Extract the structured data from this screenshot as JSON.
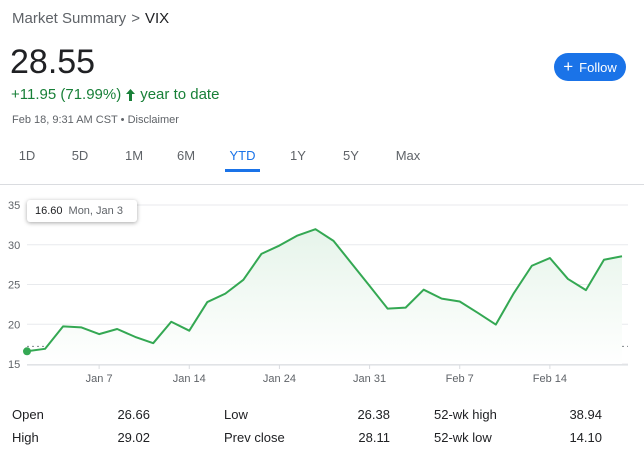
{
  "breadcrumb": {
    "parent": "Market Summary",
    "separator": ">",
    "current": "VIX"
  },
  "quote": {
    "price": "28.55",
    "change": "+11.95 (71.99%)",
    "change_icon": "arrow-up-icon",
    "period": "year to date",
    "timestamp": "Feb 18, 9:31 AM CST",
    "bullet": "•",
    "disclaimer": "Disclaimer"
  },
  "follow_button": {
    "label": "Follow",
    "icon": "plus-icon"
  },
  "tabs": [
    {
      "label": "1D",
      "active": false
    },
    {
      "label": "5D",
      "active": false
    },
    {
      "label": "1M",
      "active": false
    },
    {
      "label": "6M",
      "active": false
    },
    {
      "label": "YTD",
      "active": true
    },
    {
      "label": "1Y",
      "active": false
    },
    {
      "label": "5Y",
      "active": false
    },
    {
      "label": "Max",
      "active": false
    }
  ],
  "tooltip": {
    "value": "16.60",
    "date": "Mon, Jan 3"
  },
  "colors": {
    "accent": "#1a73e8",
    "positive": "#188038",
    "line": "#34a853",
    "fill": "#e6f4ea"
  },
  "chart_data": {
    "type": "area",
    "x_tick_labels": [
      "Jan 7",
      "Jan 14",
      "Jan 24",
      "Jan 31",
      "Feb 7",
      "Feb 14"
    ],
    "y_tick_labels": [
      "35",
      "30",
      "25",
      "20",
      "15"
    ],
    "ylim": [
      15,
      35
    ],
    "grid": true,
    "baseline": 17.22,
    "series": [
      {
        "x": [
          "Jan 3",
          "Jan 4",
          "Jan 5",
          "Jan 6",
          "Jan 7",
          "Jan 10",
          "Jan 11",
          "Jan 12",
          "Jan 13",
          "Jan 14",
          "Jan 18",
          "Jan 19",
          "Jan 20",
          "Jan 21",
          "Jan 24",
          "Jan 25",
          "Jan 26",
          "Jan 27",
          "Jan 28",
          "Jan 31",
          "Feb 1",
          "Feb 2",
          "Feb 3",
          "Feb 4",
          "Feb 7",
          "Feb 8",
          "Feb 9",
          "Feb 10",
          "Feb 11",
          "Feb 14",
          "Feb 15",
          "Feb 16",
          "Feb 17",
          "Feb 18"
        ],
        "values": [
          16.6,
          16.91,
          19.73,
          19.61,
          18.76,
          19.4,
          18.41,
          17.62,
          20.31,
          19.19,
          22.79,
          23.85,
          25.59,
          28.85,
          29.9,
          31.16,
          31.96,
          30.49,
          27.66,
          24.83,
          21.96,
          22.09,
          24.35,
          23.22,
          22.86,
          21.44,
          19.96,
          23.91,
          27.36,
          28.33,
          25.7,
          24.29,
          28.11,
          28.55
        ]
      }
    ]
  },
  "stats": [
    {
      "label": "Open",
      "value": "26.66"
    },
    {
      "label": "High",
      "value": "29.02"
    },
    {
      "label": "Low",
      "value": "26.38"
    },
    {
      "label": "Prev close",
      "value": "28.11"
    },
    {
      "label": "52-wk high",
      "value": "38.94"
    },
    {
      "label": "52-wk low",
      "value": "14.10"
    }
  ]
}
